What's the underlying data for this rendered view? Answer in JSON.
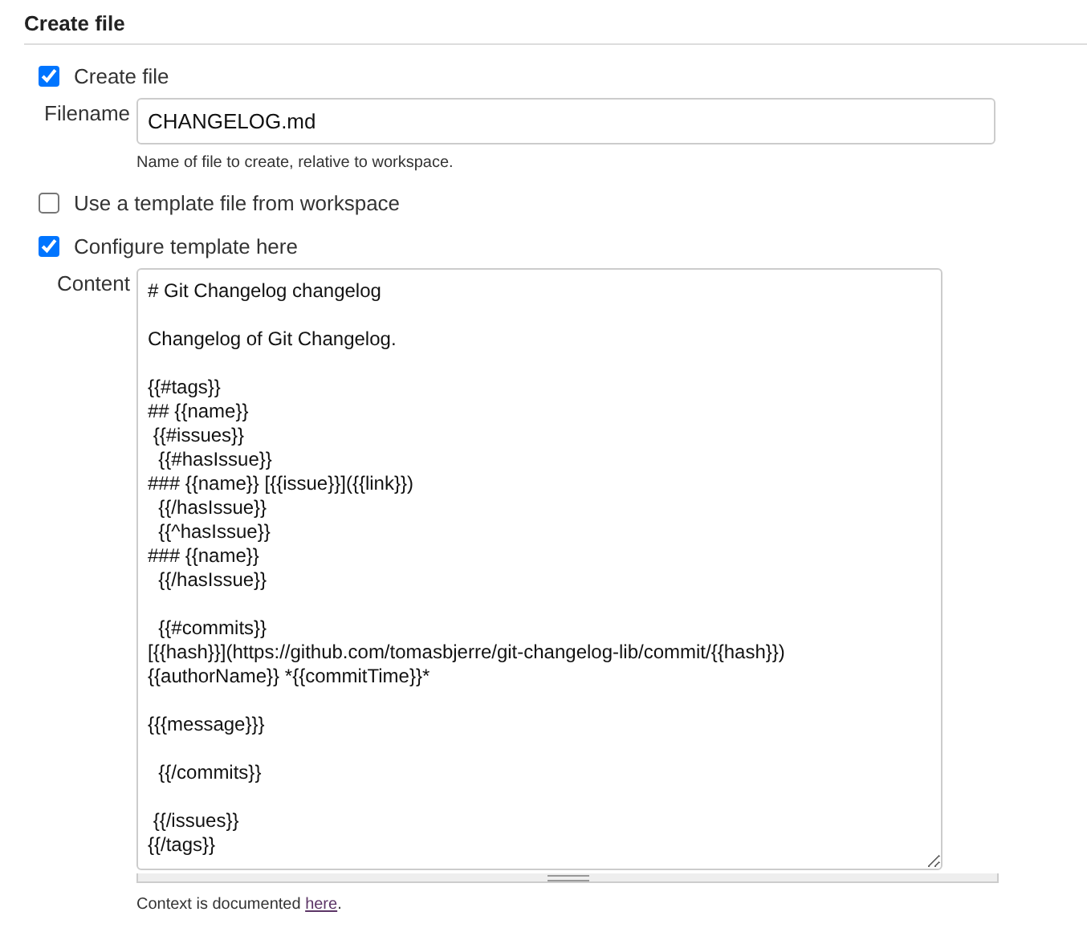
{
  "section": {
    "title": "Create file"
  },
  "options": [
    {
      "label": "Create file",
      "checked": true,
      "field": {
        "label": "Filename",
        "value": "CHANGELOG.md",
        "help": "Name of file to create, relative to workspace."
      }
    },
    {
      "label": "Use a template file from workspace",
      "checked": false
    },
    {
      "label": "Configure template here",
      "checked": true,
      "content": {
        "label": "Content",
        "value": "# Git Changelog changelog\n\nChangelog of Git Changelog.\n\n{{#tags}}\n## {{name}}\n {{#issues}}\n  {{#hasIssue}}\n### {{name}} [{{issue}}]({{link}})\n  {{/hasIssue}}\n  {{^hasIssue}}\n### {{name}}\n  {{/hasIssue}}\n\n  {{#commits}}\n[{{hash}}](https://github.com/tomasbjerre/git-changelog-lib/commit/{{hash}})\n{{authorName}} *{{commitTime}}*\n\n{{{message}}}\n\n  {{/commits}}\n\n {{/issues}}\n{{/tags}}",
        "help_before": "Context is documented ",
        "help_link": "here",
        "help_after": "."
      }
    }
  ]
}
